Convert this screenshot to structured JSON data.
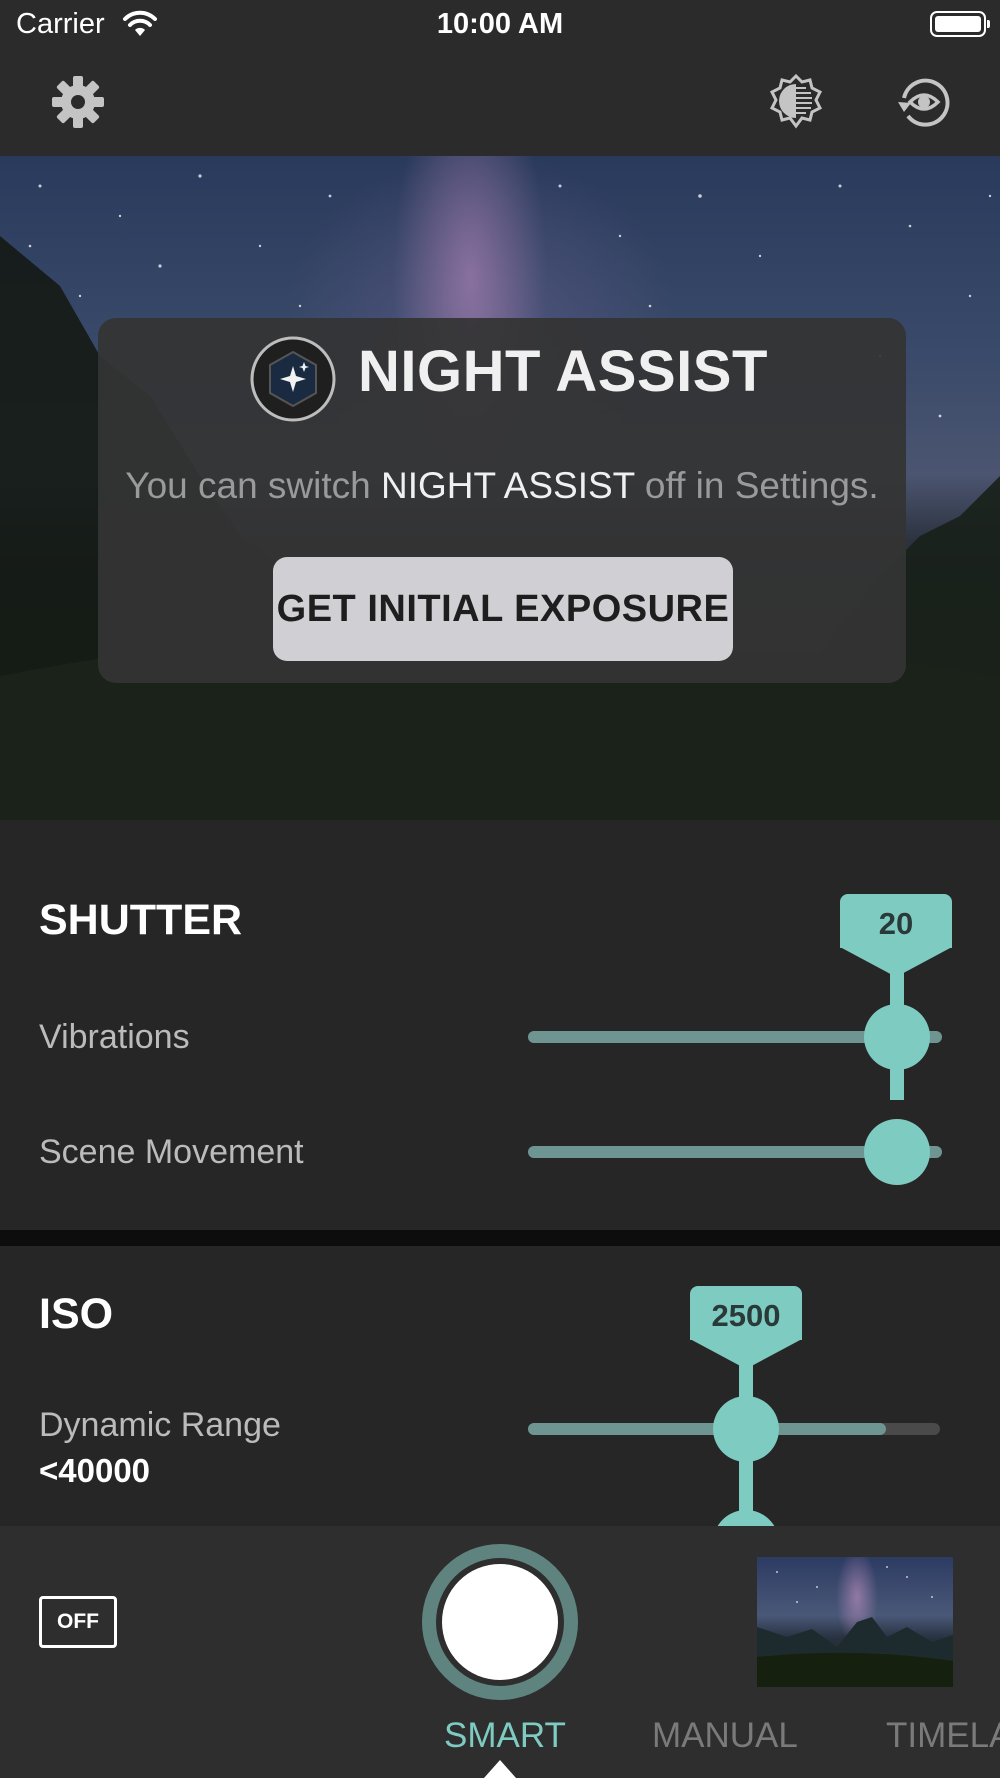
{
  "status_bar": {
    "carrier": "Carrier",
    "time": "10:00 AM"
  },
  "toolbar": {
    "icons": [
      "gear-icon",
      "exposure-meter-icon",
      "view-rotate-icon"
    ]
  },
  "night_assist": {
    "title": "NIGHT ASSIST",
    "message_prefix": "You can switch ",
    "message_highlight": "NIGHT ASSIST",
    "message_suffix": " off in Settings.",
    "button_label": "GET INITIAL EXPOSURE"
  },
  "shutter": {
    "title": "SHUTTER",
    "value": "20",
    "rows": [
      {
        "label": "Vibrations",
        "level": 0.9
      },
      {
        "label": "Scene Movement",
        "level": 0.9
      }
    ]
  },
  "iso": {
    "title": "ISO",
    "value": "2500",
    "rows": [
      {
        "label": "Dynamic Range",
        "value": "<40000",
        "level": 0.87,
        "knob": 0.53
      }
    ]
  },
  "bottom": {
    "toggle_label": "OFF",
    "modes": [
      "SMART",
      "MANUAL",
      "TIMELA"
    ],
    "active_mode": "SMART"
  },
  "colors": {
    "accent": "#7ecbc2",
    "track": "#6e9591",
    "background": "#262626"
  }
}
